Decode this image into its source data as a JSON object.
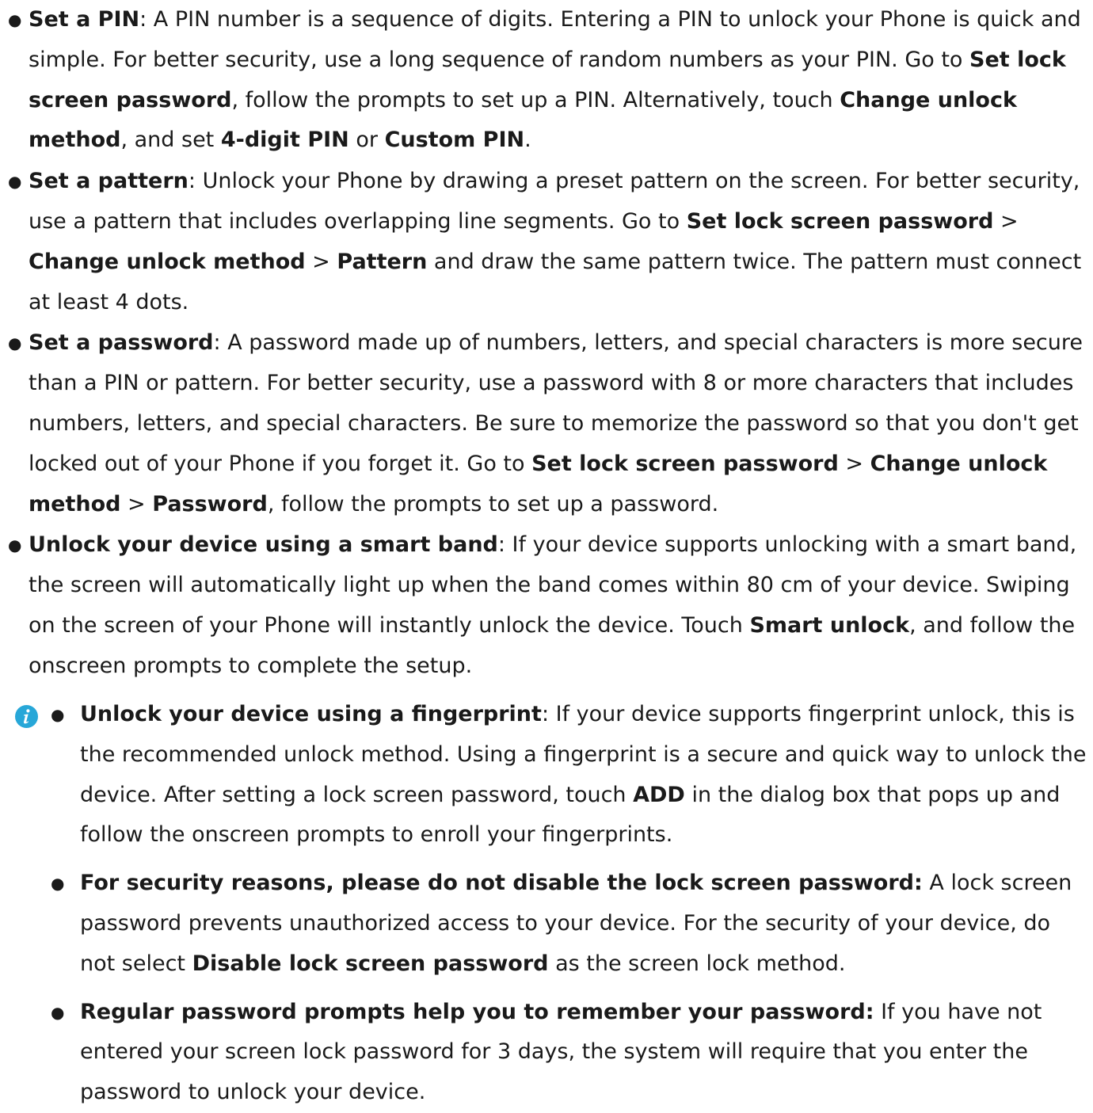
{
  "items": [
    [
      {
        "t": "Set a PIN",
        "b": true
      },
      {
        "t": ": A PIN number is a sequence of digits. Entering a PIN to unlock your Phone is quick and simple. For better security, use a long sequence of random numbers as your PIN. Go to "
      },
      {
        "t": "Set lock screen password",
        "b": true
      },
      {
        "t": ", follow the prompts to set up a PIN. Alternatively, touch "
      },
      {
        "t": "Change unlock method",
        "b": true
      },
      {
        "t": ", and set "
      },
      {
        "t": "4-digit PIN",
        "b": true
      },
      {
        "t": " or "
      },
      {
        "t": "Custom PIN",
        "b": true
      },
      {
        "t": "."
      }
    ],
    [
      {
        "t": "Set a pattern",
        "b": true
      },
      {
        "t": ": Unlock your Phone by drawing a preset pattern on the screen. For better security, use a pattern that includes overlapping line segments. Go to "
      },
      {
        "t": "Set lock screen password",
        "b": true
      },
      {
        "t": " > "
      },
      {
        "t": "Change unlock method",
        "b": true
      },
      {
        "t": " > "
      },
      {
        "t": "Pattern",
        "b": true
      },
      {
        "t": " and draw the same pattern twice. The pattern must connect at least 4 dots."
      }
    ],
    [
      {
        "t": "Set a password",
        "b": true
      },
      {
        "t": ": A password made up of numbers, letters, and special characters is more secure than a PIN or pattern. For better security, use a password with 8 or more characters that includes numbers, letters, and special characters. Be sure to memorize the password so that you don't get locked out of your Phone if you forget it. Go to "
      },
      {
        "t": "Set lock screen password",
        "b": true
      },
      {
        "t": " > "
      },
      {
        "t": "Change unlock method",
        "b": true
      },
      {
        "t": " > "
      },
      {
        "t": "Password",
        "b": true
      },
      {
        "t": ", follow the prompts to set up a password."
      }
    ],
    [
      {
        "t": "Unlock your device using a smart band",
        "b": true
      },
      {
        "t": ": If your device supports unlocking with a smart band, the screen will automatically light up when the band comes within 80 cm of your device. Swiping on the screen of your Phone will instantly unlock the device. Touch "
      },
      {
        "t": "Smart unlock",
        "b": true
      },
      {
        "t": ", and follow the onscreen prompts to complete the setup."
      }
    ]
  ],
  "note": {
    "icon": "info-icon",
    "icon_color": "#27a7d8",
    "items": [
      [
        {
          "t": "Unlock your device using a fingerprint",
          "b": true
        },
        {
          "t": ": If your device supports fingerprint unlock, this is the recommended unlock method. Using a fingerprint is a secure and quick way to unlock the device. After setting a lock screen password, touch "
        },
        {
          "t": "ADD",
          "b": true
        },
        {
          "t": " in the dialog box that pops up and follow the onscreen prompts to enroll your fingerprints."
        }
      ],
      [
        {
          "t": "For security reasons, please do not disable the lock screen password:",
          "b": true
        },
        {
          "t": " A lock screen password prevents unauthorized access to your device. For the security of your device, do not select "
        },
        {
          "t": "Disable lock screen password",
          "b": true
        },
        {
          "t": " as the screen lock method."
        }
      ],
      [
        {
          "t": "Regular password prompts help you to remember your password:",
          "b": true
        },
        {
          "t": " If you have not entered your screen lock password for 3 days, the system will require that you enter the password to unlock your device."
        }
      ]
    ]
  }
}
